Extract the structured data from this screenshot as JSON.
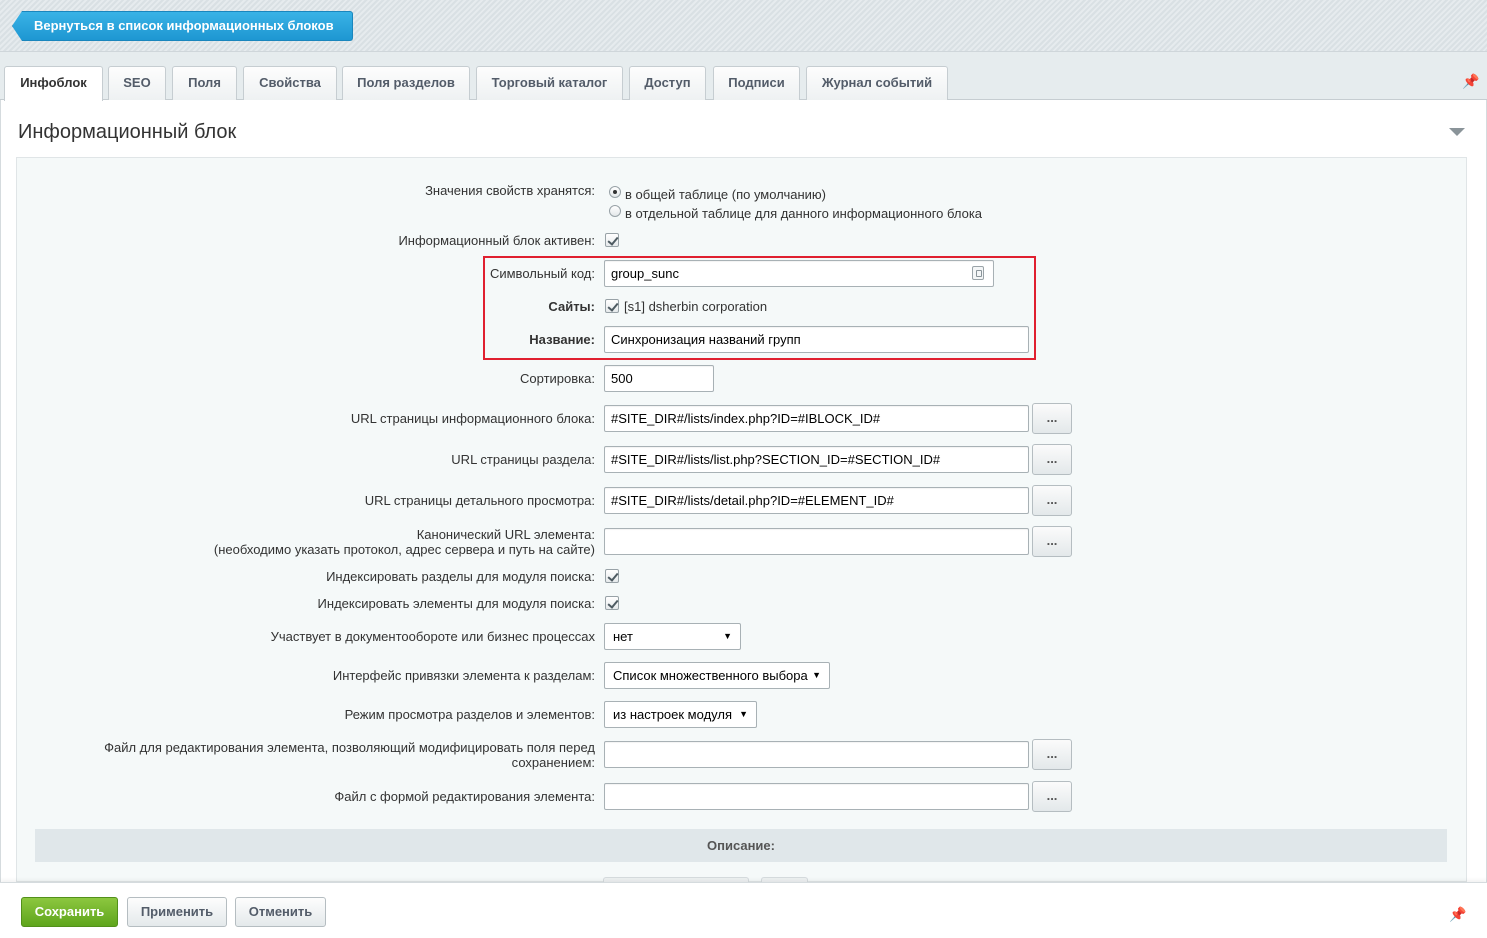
{
  "header": {
    "back_label": "Вернуться в список информационных блоков"
  },
  "tabs": [
    {
      "label": "Инфоблок",
      "active": true
    },
    {
      "label": "SEO"
    },
    {
      "label": "Поля"
    },
    {
      "label": "Свойства"
    },
    {
      "label": "Поля разделов"
    },
    {
      "label": "Торговый каталог"
    },
    {
      "label": "Доступ"
    },
    {
      "label": "Подписи"
    },
    {
      "label": "Журнал событий"
    }
  ],
  "section": {
    "title": "Информационный блок",
    "description_bar": "Описание:"
  },
  "form": {
    "storage": {
      "label": "Значения свойств хранятся:",
      "options": [
        "в общей таблице (по умолчанию)",
        "в отдельной таблице для данного информационного блока"
      ],
      "selected": 0
    },
    "active": {
      "label": "Информационный блок активен:",
      "checked": true
    },
    "code": {
      "label": "Символьный код:",
      "value": "group_sunc"
    },
    "sites": {
      "label": "Сайты:",
      "checked": true,
      "value": "[s1] dsherbin corporation"
    },
    "name": {
      "label": "Название:",
      "value": "Синхронизация названий групп"
    },
    "sort": {
      "label": "Сортировка:",
      "value": "500"
    },
    "list_url": {
      "label": "URL страницы информационного блока:",
      "value": "#SITE_DIR#/lists/index.php?ID=#IBLOCK_ID#"
    },
    "section_url": {
      "label": "URL страницы раздела:",
      "value": "#SITE_DIR#/lists/list.php?SECTION_ID=#SECTION_ID#"
    },
    "detail_url": {
      "label": "URL страницы детального просмотра:",
      "value": "#SITE_DIR#/lists/detail.php?ID=#ELEMENT_ID#"
    },
    "canonical_url": {
      "label_line1": "Канонический URL элемента:",
      "label_line2": "(необходимо указать протокол, адрес сервера и путь на сайте)",
      "value": ""
    },
    "index_sections": {
      "label": "Индексировать разделы для модуля поиска:",
      "checked": true
    },
    "index_elements": {
      "label": "Индексировать элементы для модуля поиска:",
      "checked": true
    },
    "workflow": {
      "label": "Участвует в документообороте или бизнес процессах",
      "value": "нет"
    },
    "section_interface": {
      "label": "Интерфейс привязки элемента к разделам:",
      "value": "Список множественного выбора"
    },
    "view_mode": {
      "label": "Режим просмотра разделов и элементов:",
      "value": "из настроек модуля"
    },
    "edit_file": {
      "label_line1": "Файл для редактирования элемента, позволяющий модифицировать поля перед",
      "label_line2": "сохранением:",
      "value": ""
    },
    "form_file": {
      "label": "Файл с формой редактирования элемента:",
      "value": ""
    },
    "dots_label": "..."
  },
  "footer": {
    "save": "Сохранить",
    "apply": "Применить",
    "cancel": "Отменить"
  },
  "icons": {
    "pin": "pin-icon",
    "collapse": "chevron-down-icon",
    "lock": "lock-icon"
  },
  "colors": {
    "back_button": "#1e97d2",
    "save_button": "#6bb32a",
    "highlight_border": "#e02030"
  }
}
